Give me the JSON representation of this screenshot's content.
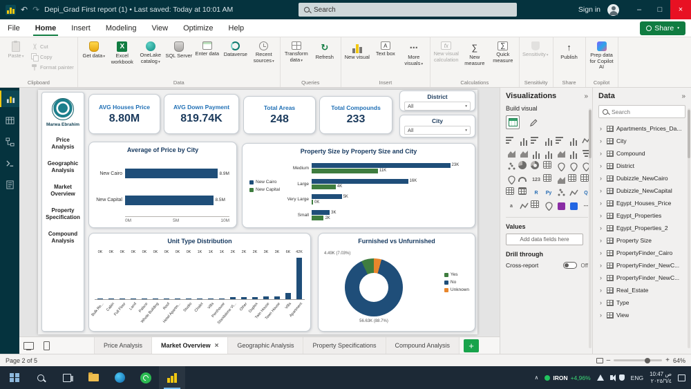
{
  "colors": {
    "accent_green": "#107C41",
    "titlebar_bg": "#05333E",
    "bar_blue": "#1F4E79",
    "bar_green": "#3F7D3F",
    "slice_orange": "#E8862C",
    "kpi_title_blue": "#1F6FB5"
  },
  "titlebar": {
    "app_title": "Depi_Grad First report (1) • Last saved: Today at 10:01 AM",
    "search_placeholder": "Search",
    "sign_in_label": "Sign in"
  },
  "menubar": {
    "tabs": [
      "File",
      "Home",
      "Insert",
      "Modeling",
      "View",
      "Optimize",
      "Help"
    ],
    "active_tab": "Home",
    "share_label": "Share"
  },
  "ribbon": {
    "groups": [
      {
        "label": "Clipboard",
        "buttons": [
          {
            "label": "Paste",
            "icon": "paste",
            "large": true,
            "disabled": true,
            "dropdown": true
          },
          {
            "label": "Cut",
            "icon": "cut",
            "small": true,
            "disabled": true
          },
          {
            "label": "Copy",
            "icon": "copy",
            "small": true,
            "disabled": true
          },
          {
            "label": "Format painter",
            "icon": "painter",
            "small": true,
            "disabled": true
          }
        ]
      },
      {
        "label": "Data",
        "buttons": [
          {
            "label": "Get data",
            "icon": "getdata",
            "dropdown": true
          },
          {
            "label": "Excel workbook",
            "icon": "excel"
          },
          {
            "label": "OneLake catalog",
            "icon": "onelake",
            "dropdown": true
          },
          {
            "label": "SQL Server",
            "icon": "sql"
          },
          {
            "label": "Enter data",
            "icon": "enterdata"
          },
          {
            "label": "Dataverse",
            "icon": "dataverse"
          },
          {
            "label": "Recent sources",
            "icon": "recent",
            "dropdown": true
          }
        ]
      },
      {
        "label": "Queries",
        "buttons": [
          {
            "label": "Transform data",
            "icon": "transform",
            "dropdown": true
          },
          {
            "label": "Refresh",
            "icon": "refresh"
          }
        ]
      },
      {
        "label": "Insert",
        "buttons": [
          {
            "label": "New visual",
            "icon": "newvisual"
          },
          {
            "label": "Text box",
            "icon": "textbox"
          },
          {
            "label": "More visuals",
            "icon": "morevisuals",
            "dropdown": true
          }
        ]
      },
      {
        "label": "Calculations",
        "buttons": [
          {
            "label": "New visual calculation",
            "icon": "visualcalc",
            "disabled": true
          },
          {
            "label": "New measure",
            "icon": "measure"
          },
          {
            "label": "Quick measure",
            "icon": "quickmeasure"
          }
        ]
      },
      {
        "label": "Sensitivity",
        "buttons": [
          {
            "label": "Sensitivity",
            "icon": "sensitivity",
            "disabled": true,
            "dropdown": true
          }
        ]
      },
      {
        "label": "Share",
        "buttons": [
          {
            "label": "Publish",
            "icon": "publish"
          }
        ]
      },
      {
        "label": "Copilot",
        "buttons": [
          {
            "label": "Prep data for Copilot AI",
            "icon": "copilot"
          }
        ]
      }
    ]
  },
  "rail": {
    "items": [
      {
        "name": "report-view",
        "active": true
      },
      {
        "name": "table-view",
        "active": false
      },
      {
        "name": "model-view",
        "active": false
      },
      {
        "name": "dax-query-view",
        "active": false
      },
      {
        "name": "tmdl-view",
        "active": false
      }
    ]
  },
  "dashboard": {
    "nav": {
      "author": "Marwa Ebrahim",
      "items": [
        "Price Analysis",
        "Geographic Analysis",
        "Market Overview",
        "Property Specification",
        "Compound Analysis"
      ]
    },
    "kpis": [
      {
        "title": "AVG Houses Price",
        "value": "8.80M"
      },
      {
        "title": "AVG Down Payment",
        "value": "819.74K"
      },
      {
        "title": "Total Areas",
        "value": "248"
      },
      {
        "title": "Total Compounds",
        "value": "233"
      }
    ],
    "slicers": [
      {
        "title": "District",
        "value": "All"
      },
      {
        "title": "City",
        "value": "All"
      }
    ]
  },
  "chart_data": [
    {
      "type": "bar",
      "orientation": "horizontal",
      "title": "Average of Price by City",
      "categories": [
        "New Cairo",
        "New Capital"
      ],
      "values": [
        8.9,
        8.5
      ],
      "value_labels": [
        "8.9M",
        "8.5M"
      ],
      "x_ticks": [
        "0M",
        "5M",
        "10M"
      ],
      "xlim": [
        0,
        10
      ],
      "bar_color": "#1F4E79"
    },
    {
      "type": "bar",
      "orientation": "horizontal",
      "grouped": true,
      "title": "Property Size by Property Size and City",
      "categories": [
        "Medium",
        "Large",
        "Very Large",
        "Small"
      ],
      "series": [
        {
          "name": "New Cairo",
          "color": "#1F4E79",
          "values": [
            23,
            16,
            5,
            3
          ],
          "value_labels": [
            "23K",
            "16K",
            "5K",
            "3K"
          ]
        },
        {
          "name": "New Capital",
          "color": "#3F7D3F",
          "values": [
            11,
            4,
            0,
            2
          ],
          "value_labels": [
            "11K",
            "4K",
            "0K",
            "2K"
          ]
        }
      ],
      "xlim": [
        0,
        25
      ],
      "legend_position": "left"
    },
    {
      "type": "bar",
      "orientation": "vertical",
      "title": "Unit Type Distribution",
      "categories": [
        "Bulk Re...",
        "Cabin",
        "Full Floor",
        "Land",
        "Palace",
        "Whole Building",
        "Roof",
        "Hotel Apartm...",
        "Studio",
        "Chalet",
        "Villa",
        "Penthouse",
        "Standalone Vi...",
        "Other",
        "Duplex",
        "Twin House",
        "Town House",
        "Villa",
        "Apartment"
      ],
      "values": [
        0,
        0,
        0,
        0,
        0,
        0,
        0,
        0,
        0,
        1,
        1,
        1,
        2,
        2,
        2,
        3,
        3,
        6,
        42
      ],
      "value_labels": [
        "0K",
        "0K",
        "0K",
        "0K",
        "0K",
        "0K",
        "0K",
        "0K",
        "0K",
        "1K",
        "1K",
        "1K",
        "2K",
        "2K",
        "2K",
        "3K",
        "3K",
        "6K",
        "42K"
      ],
      "ylim": [
        0,
        42
      ],
      "bar_color": "#1F4E79"
    },
    {
      "type": "donut",
      "title": "Furnished vs Unfurnished",
      "slices": [
        {
          "name": "No",
          "value": 88.7,
          "label": "56.63K (88.7%)",
          "color": "#1F4E79"
        },
        {
          "name": "Yes",
          "value": 7.03,
          "label": "4.49K (7.03%)",
          "color": "#3F7D3F"
        },
        {
          "name": "Unknown",
          "value": 4.27,
          "label": "",
          "color": "#E8862C"
        }
      ],
      "legend": [
        "Yes",
        "No",
        "Unknown"
      ],
      "legend_colors": [
        "#3F7D3F",
        "#1F4E79",
        "#E8862C"
      ],
      "legend_position": "right"
    }
  ],
  "visualizations": {
    "title": "Visualizations",
    "build_visual_label": "Build visual",
    "icons": [
      "stacked-bar-chart",
      "stacked-column-chart",
      "clustered-bar-chart",
      "clustered-column-chart",
      "100-stacked-bar-chart",
      "100-stacked-column-chart",
      "line-chart",
      "area-chart",
      "stacked-area-chart",
      "line-and-stacked-column-chart",
      "line-and-clustered-column-chart",
      "ribbon-chart",
      "waterfall-chart",
      "funnel-chart",
      "scatter-chart",
      "pie-chart",
      "donut-chart",
      "treemap",
      "map",
      "filled-map",
      "shape-map",
      "azure-map",
      "gauge",
      "card",
      "multi-row-card",
      "kpi",
      "slicer",
      "text-slicer",
      "table",
      "matrix",
      "r-script-visual",
      "python-visual",
      "key-influencers",
      "decomposition-tree",
      "q-and-a",
      "smart-narrative",
      "metrics",
      "paginated-report",
      "arcgis-map",
      "power-apps",
      "power-automate",
      "get-more-visuals"
    ],
    "values_label": "Values",
    "values_placeholder": "Add data fields here",
    "drill_through_label": "Drill through",
    "cross_report_label": "Cross-report",
    "cross_report_state": "Off"
  },
  "data_panel": {
    "title": "Data",
    "search_placeholder": "Search",
    "fields": [
      "Apartments_Prices_Da...",
      "City",
      "Compound",
      "District",
      "Dubizzle_NewCairo",
      "Dubizzle_NewCapital",
      "Egypt_Houses_Price",
      "Egypt_Properties",
      "Egypt_Properties_2",
      "Property Size",
      "PropertyFinder_Cairo",
      "PropertyFinder_NewC...",
      "PropertyFinder_NewC...",
      "Real_Estate",
      "Type",
      "View"
    ]
  },
  "pages": {
    "tabs": [
      "Price Analysis",
      "Market Overview",
      "Geographic Analysis",
      "Property Specifications",
      "Compound Analysis"
    ],
    "active_tab": "Market Overview",
    "add_label": "+"
  },
  "statusbar": {
    "page_indicator": "Page 2 of 5",
    "zoom_level": "64%"
  },
  "taskbar": {
    "icons": [
      "start",
      "search",
      "task-view",
      "file-explorer",
      "edge",
      "whatsapp",
      "power-bi"
    ],
    "active_icon": "power-bi",
    "tray": {
      "ticker_symbol": "IRON",
      "ticker_change": "+4,96%",
      "language": "ENG",
      "time": "10:47 ص",
      "date": "٢٠٢٥/٦/٤"
    }
  }
}
